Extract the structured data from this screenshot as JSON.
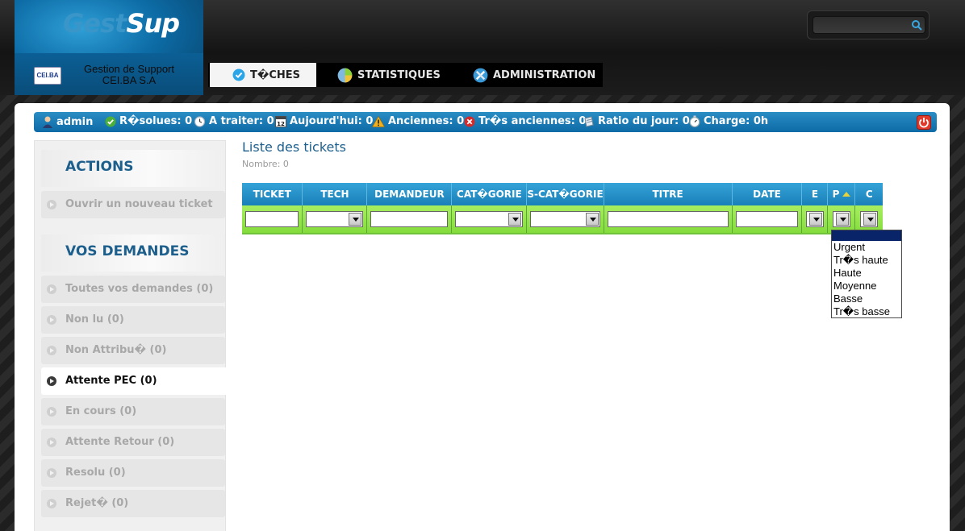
{
  "brand": {
    "part1": "Gest",
    "part2": "Sup"
  },
  "company": {
    "badge": "CEI.BA",
    "line1": "Gestion de Support",
    "line2": "CEI.BA S.A"
  },
  "search": {
    "placeholder": ""
  },
  "nav": {
    "tabs": [
      {
        "label": "T�CHES",
        "active": true,
        "icon": "check-circle-icon"
      },
      {
        "label": "STATISTIQUES",
        "active": false,
        "icon": "pie-chart-icon"
      },
      {
        "label": "ADMINISTRATION",
        "active": false,
        "icon": "tools-icon"
      }
    ]
  },
  "status": {
    "user": "admin",
    "items": [
      {
        "label": "R�solues:",
        "value": "0",
        "icon": "check-icon"
      },
      {
        "label": "A traiter:",
        "value": "0",
        "icon": "alarm-clock-icon"
      },
      {
        "label": "Aujourd'hui:",
        "value": "0",
        "icon": "calendar-icon"
      },
      {
        "label": "Anciennes:",
        "value": "0",
        "icon": "warning-icon"
      },
      {
        "label": "Tr�s anciennes:",
        "value": "0",
        "icon": "error-icon"
      },
      {
        "label": "Ratio du jour:",
        "value": "0",
        "icon": "notepad-icon"
      },
      {
        "label": "Charge:",
        "value": "0h",
        "icon": "stopwatch-icon"
      }
    ]
  },
  "sidebar": {
    "actions_title": "ACTIONS",
    "new_ticket": "Ouvrir un nouveau ticket",
    "requests_title": "VOS DEMANDES",
    "items": [
      {
        "label": "Toutes vos demandes (0)",
        "active": false
      },
      {
        "label": "Non lu (0)",
        "active": false
      },
      {
        "label": "Non Attribu� (0)",
        "active": false
      },
      {
        "label": "Attente PEC (0)",
        "active": true
      },
      {
        "label": "En cours (0)",
        "active": false
      },
      {
        "label": "Attente Retour (0)",
        "active": false
      },
      {
        "label": "Resolu (0)",
        "active": false
      },
      {
        "label": "Rejet� (0)",
        "active": false
      }
    ]
  },
  "content": {
    "title": "Liste des tickets",
    "count": "Nombre: 0"
  },
  "table": {
    "columns": [
      "TICKET",
      "TECH",
      "DEMANDEUR",
      "CAT�GORIE",
      "S-CAT�GORIE",
      "TITRE",
      "DATE",
      "E",
      "P",
      "C"
    ]
  },
  "priority_dropdown": {
    "options": [
      "",
      "Urgent",
      "Tr�s haute",
      "Haute",
      "Moyenne",
      "Basse",
      "Tr�s basse"
    ],
    "selected_index": 0
  },
  "colors": {
    "accent": "#1a7fb8",
    "filter_row": "#94e44c",
    "title": "#1d5f8c"
  }
}
